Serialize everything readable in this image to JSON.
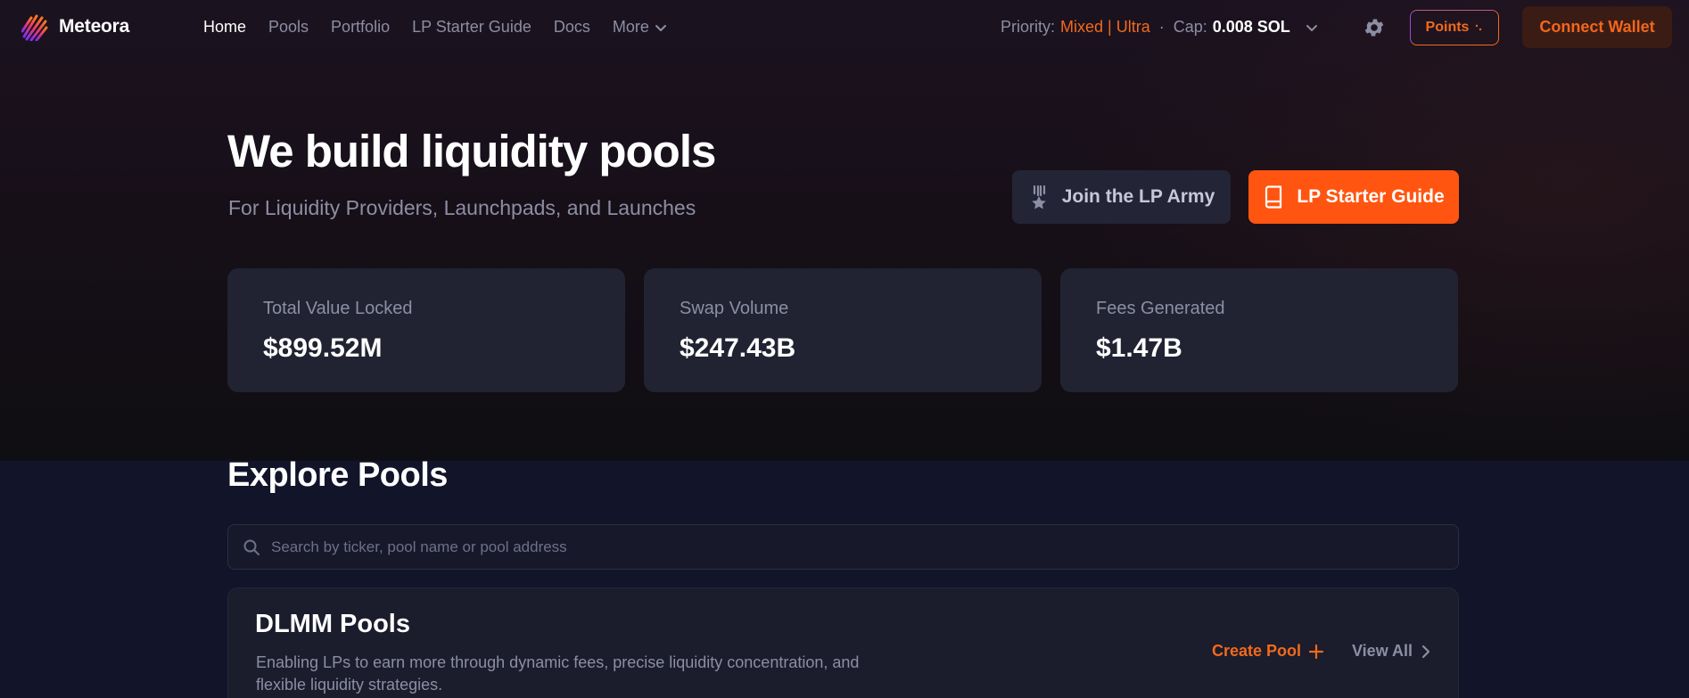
{
  "app": {
    "name": "Meteora"
  },
  "nav": {
    "links": [
      "Home",
      "Pools",
      "Portfolio",
      "LP Starter Guide",
      "Docs",
      "More"
    ],
    "priority_label": "Priority:",
    "priority_value": "Mixed | Ultra",
    "separator": "·",
    "cap_label": "Cap:",
    "cap_value": "0.008 SOL",
    "points_label": "Points",
    "connect_label": "Connect Wallet"
  },
  "hero": {
    "title": "We build liquidity pools",
    "subtitle": "For Liquidity Providers, Launchpads, and Launches",
    "lp_army_label": "Join the LP Army",
    "starter_label": "LP Starter Guide"
  },
  "stats": [
    {
      "label": "Total Value Locked",
      "value": "$899.52M"
    },
    {
      "label": "Swap Volume",
      "value": "$247.43B"
    },
    {
      "label": "Fees Generated",
      "value": "$1.47B"
    }
  ],
  "explore": {
    "title": "Explore Pools",
    "search_placeholder": "Search by ticker, pool name or pool address"
  },
  "dlmm": {
    "title": "DLMM Pools",
    "description": "Enabling LPs to earn more through dynamic fees, precise liquidity concentration, and flexible liquidity strategies.",
    "create_label": "Create Pool",
    "view_all_label": "View All"
  },
  "colors": {
    "accent": "#f26a1b",
    "primary_button": "#ff5511",
    "card": "#212332",
    "muted_text": "#8c8ea3"
  }
}
